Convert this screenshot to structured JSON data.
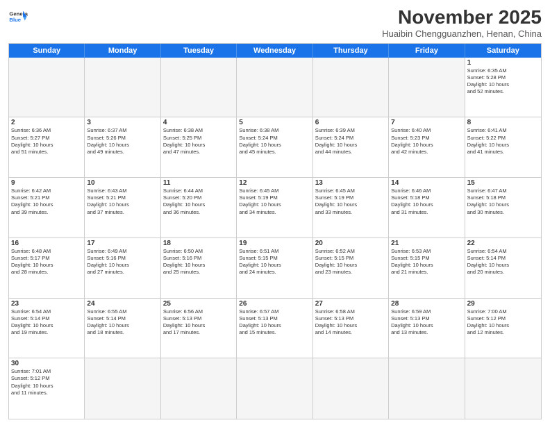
{
  "header": {
    "logo_general": "General",
    "logo_blue": "Blue",
    "month_title": "November 2025",
    "location": "Huaibin Chengguanzhen, Henan, China"
  },
  "days_of_week": [
    "Sunday",
    "Monday",
    "Tuesday",
    "Wednesday",
    "Thursday",
    "Friday",
    "Saturday"
  ],
  "cells": [
    {
      "day": "",
      "empty": true,
      "info": ""
    },
    {
      "day": "",
      "empty": true,
      "info": ""
    },
    {
      "day": "",
      "empty": true,
      "info": ""
    },
    {
      "day": "",
      "empty": true,
      "info": ""
    },
    {
      "day": "",
      "empty": true,
      "info": ""
    },
    {
      "day": "",
      "empty": true,
      "info": ""
    },
    {
      "day": "1",
      "empty": false,
      "info": "Sunrise: 6:35 AM\nSunset: 5:28 PM\nDaylight: 10 hours\nand 52 minutes."
    },
    {
      "day": "2",
      "empty": false,
      "info": "Sunrise: 6:36 AM\nSunset: 5:27 PM\nDaylight: 10 hours\nand 51 minutes."
    },
    {
      "day": "3",
      "empty": false,
      "info": "Sunrise: 6:37 AM\nSunset: 5:26 PM\nDaylight: 10 hours\nand 49 minutes."
    },
    {
      "day": "4",
      "empty": false,
      "info": "Sunrise: 6:38 AM\nSunset: 5:25 PM\nDaylight: 10 hours\nand 47 minutes."
    },
    {
      "day": "5",
      "empty": false,
      "info": "Sunrise: 6:38 AM\nSunset: 5:24 PM\nDaylight: 10 hours\nand 45 minutes."
    },
    {
      "day": "6",
      "empty": false,
      "info": "Sunrise: 6:39 AM\nSunset: 5:24 PM\nDaylight: 10 hours\nand 44 minutes."
    },
    {
      "day": "7",
      "empty": false,
      "info": "Sunrise: 6:40 AM\nSunset: 5:23 PM\nDaylight: 10 hours\nand 42 minutes."
    },
    {
      "day": "8",
      "empty": false,
      "info": "Sunrise: 6:41 AM\nSunset: 5:22 PM\nDaylight: 10 hours\nand 41 minutes."
    },
    {
      "day": "9",
      "empty": false,
      "info": "Sunrise: 6:42 AM\nSunset: 5:21 PM\nDaylight: 10 hours\nand 39 minutes."
    },
    {
      "day": "10",
      "empty": false,
      "info": "Sunrise: 6:43 AM\nSunset: 5:21 PM\nDaylight: 10 hours\nand 37 minutes."
    },
    {
      "day": "11",
      "empty": false,
      "info": "Sunrise: 6:44 AM\nSunset: 5:20 PM\nDaylight: 10 hours\nand 36 minutes."
    },
    {
      "day": "12",
      "empty": false,
      "info": "Sunrise: 6:45 AM\nSunset: 5:19 PM\nDaylight: 10 hours\nand 34 minutes."
    },
    {
      "day": "13",
      "empty": false,
      "info": "Sunrise: 6:45 AM\nSunset: 5:19 PM\nDaylight: 10 hours\nand 33 minutes."
    },
    {
      "day": "14",
      "empty": false,
      "info": "Sunrise: 6:46 AM\nSunset: 5:18 PM\nDaylight: 10 hours\nand 31 minutes."
    },
    {
      "day": "15",
      "empty": false,
      "info": "Sunrise: 6:47 AM\nSunset: 5:18 PM\nDaylight: 10 hours\nand 30 minutes."
    },
    {
      "day": "16",
      "empty": false,
      "info": "Sunrise: 6:48 AM\nSunset: 5:17 PM\nDaylight: 10 hours\nand 28 minutes."
    },
    {
      "day": "17",
      "empty": false,
      "info": "Sunrise: 6:49 AM\nSunset: 5:16 PM\nDaylight: 10 hours\nand 27 minutes."
    },
    {
      "day": "18",
      "empty": false,
      "info": "Sunrise: 6:50 AM\nSunset: 5:16 PM\nDaylight: 10 hours\nand 25 minutes."
    },
    {
      "day": "19",
      "empty": false,
      "info": "Sunrise: 6:51 AM\nSunset: 5:15 PM\nDaylight: 10 hours\nand 24 minutes."
    },
    {
      "day": "20",
      "empty": false,
      "info": "Sunrise: 6:52 AM\nSunset: 5:15 PM\nDaylight: 10 hours\nand 23 minutes."
    },
    {
      "day": "21",
      "empty": false,
      "info": "Sunrise: 6:53 AM\nSunset: 5:15 PM\nDaylight: 10 hours\nand 21 minutes."
    },
    {
      "day": "22",
      "empty": false,
      "info": "Sunrise: 6:54 AM\nSunset: 5:14 PM\nDaylight: 10 hours\nand 20 minutes."
    },
    {
      "day": "23",
      "empty": false,
      "info": "Sunrise: 6:54 AM\nSunset: 5:14 PM\nDaylight: 10 hours\nand 19 minutes."
    },
    {
      "day": "24",
      "empty": false,
      "info": "Sunrise: 6:55 AM\nSunset: 5:14 PM\nDaylight: 10 hours\nand 18 minutes."
    },
    {
      "day": "25",
      "empty": false,
      "info": "Sunrise: 6:56 AM\nSunset: 5:13 PM\nDaylight: 10 hours\nand 17 minutes."
    },
    {
      "day": "26",
      "empty": false,
      "info": "Sunrise: 6:57 AM\nSunset: 5:13 PM\nDaylight: 10 hours\nand 15 minutes."
    },
    {
      "day": "27",
      "empty": false,
      "info": "Sunrise: 6:58 AM\nSunset: 5:13 PM\nDaylight: 10 hours\nand 14 minutes."
    },
    {
      "day": "28",
      "empty": false,
      "info": "Sunrise: 6:59 AM\nSunset: 5:13 PM\nDaylight: 10 hours\nand 13 minutes."
    },
    {
      "day": "29",
      "empty": false,
      "info": "Sunrise: 7:00 AM\nSunset: 5:12 PM\nDaylight: 10 hours\nand 12 minutes."
    },
    {
      "day": "30",
      "empty": false,
      "info": "Sunrise: 7:01 AM\nSunset: 5:12 PM\nDaylight: 10 hours\nand 11 minutes."
    },
    {
      "day": "",
      "empty": true,
      "info": ""
    },
    {
      "day": "",
      "empty": true,
      "info": ""
    },
    {
      "day": "",
      "empty": true,
      "info": ""
    },
    {
      "day": "",
      "empty": true,
      "info": ""
    },
    {
      "day": "",
      "empty": true,
      "info": ""
    },
    {
      "day": "",
      "empty": true,
      "info": ""
    }
  ]
}
